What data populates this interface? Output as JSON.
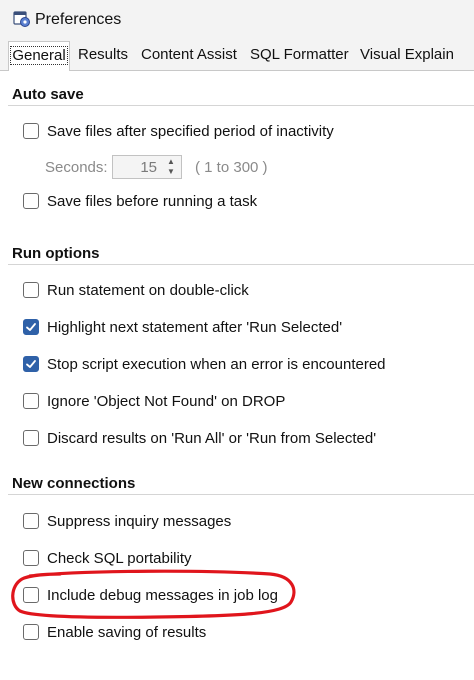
{
  "window": {
    "title": "Preferences",
    "icon": "preferences-app-icon"
  },
  "tabs": [
    {
      "label": "General",
      "active": true
    },
    {
      "label": "Results",
      "active": false
    },
    {
      "label": "Content Assist",
      "active": false
    },
    {
      "label": "SQL Formatter",
      "active": false
    },
    {
      "label": "Visual Explain",
      "active": false
    }
  ],
  "auto_save": {
    "title": "Auto save",
    "save_inactivity": {
      "label": "Save files after specified period of inactivity",
      "checked": false
    },
    "seconds": {
      "label": "Seconds:",
      "value": "15",
      "range": "( 1 to 300 )"
    },
    "save_before_task": {
      "label": "Save files before running a task",
      "checked": false
    }
  },
  "run_options": {
    "title": "Run options",
    "items": [
      {
        "label": "Run statement on double-click",
        "checked": false
      },
      {
        "label": "Highlight next statement after 'Run Selected'",
        "checked": true
      },
      {
        "label": "Stop script execution when an error is encountered",
        "checked": true
      },
      {
        "label": "Ignore 'Object Not Found' on DROP",
        "checked": false
      },
      {
        "label": "Discard results on 'Run All' or 'Run from Selected'",
        "checked": false
      }
    ]
  },
  "new_connections": {
    "title": "New connections",
    "items": [
      {
        "label": "Suppress inquiry messages",
        "checked": false
      },
      {
        "label": "Check SQL portability",
        "checked": false
      },
      {
        "label": "Include debug messages in job log",
        "checked": false
      },
      {
        "label": "Enable saving of results",
        "checked": false
      }
    ]
  },
  "colors": {
    "accent": "#2f61a8",
    "annotation": "#e0151c",
    "background": "#ffffff",
    "chrome": "#f3f3f3"
  }
}
